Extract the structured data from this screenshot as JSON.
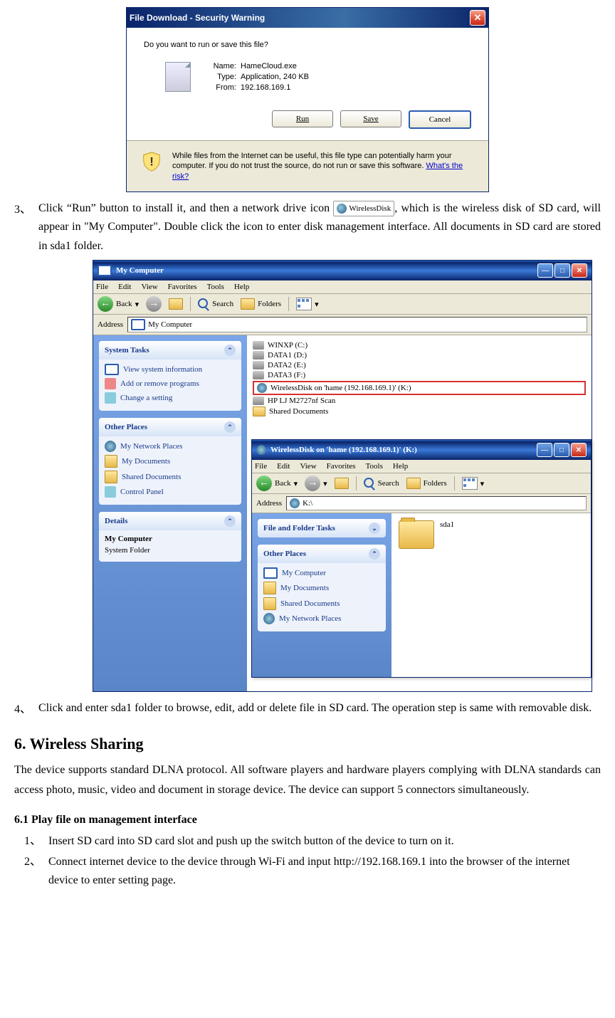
{
  "dialog": {
    "title": "File Download - Security Warning",
    "question": "Do you want to run or save this file?",
    "name_label": "Name:",
    "name_value": "HameCloud.exe",
    "type_label": "Type:",
    "type_value": "Application, 240 KB",
    "from_label": "From:",
    "from_value": "192.168.169.1",
    "btn_run": "Run",
    "btn_save": "Save",
    "btn_cancel": "Cancel",
    "warning": "While files from the Internet can be useful, this file type can potentially harm your computer. If you do not trust the source, do not run or save this software. ",
    "warning_link": "What's the risk?"
  },
  "step3": {
    "num": "3、",
    "t1": "Click “Run” button to install it, and then a network drive icon",
    "icon_label": "WirelessDisk",
    "t2": ", which is the wireless disk of SD card, will appear in \"My Computer\". Double click the icon to enter disk management interface. All documents in SD card are stored in sda1 folder."
  },
  "explorer1": {
    "title": "My Computer",
    "menu": [
      "File",
      "Edit",
      "View",
      "Favorites",
      "Tools",
      "Help"
    ],
    "toolbar": {
      "back": "Back",
      "search": "Search",
      "folders": "Folders"
    },
    "address_label": "Address",
    "address_value": "My Computer",
    "sidebar": {
      "panel1": {
        "title": "System Tasks",
        "items": [
          "View system information",
          "Add or remove programs",
          "Change a setting"
        ]
      },
      "panel2": {
        "title": "Other Places",
        "items": [
          "My Network Places",
          "My Documents",
          "Shared Documents",
          "Control Panel"
        ]
      },
      "panel3": {
        "title": "Details",
        "item": "My Computer",
        "sub": "System Folder"
      }
    },
    "drives": [
      "WINXP (C:)",
      "DATA1 (D:)",
      "DATA2 (E:)",
      "DATA3 (F:)"
    ],
    "hl_drive": "WirelessDisk on 'hame (192.168.169.1)' (K:)",
    "extra": [
      "HP LJ M2727nf Scan",
      "Shared Documents"
    ]
  },
  "explorer2": {
    "title": "WirelessDisk on 'hame (192.168.169.1)' (K:)",
    "menu": [
      "File",
      "Edit",
      "View",
      "Favorites",
      "Tools",
      "Help"
    ],
    "toolbar": {
      "back": "Back",
      "search": "Search",
      "folders": "Folders"
    },
    "address_label": "Address",
    "address_value": "K:\\",
    "sidebar": {
      "panel1": {
        "title": "File and Folder Tasks"
      },
      "panel2": {
        "title": "Other Places",
        "items": [
          "My Computer",
          "My Documents",
          "Shared Documents",
          "My Network Places"
        ]
      }
    },
    "folder": "sda1"
  },
  "step4": {
    "num": "4、",
    "text": "Click and enter sda1 folder to browse, edit, add or delete file in SD card. The operation step is same with removable disk."
  },
  "section6": {
    "heading": "6. Wireless Sharing",
    "body": "The device supports standard DLNA protocol. All software players and hardware players complying with DLNA standards can access photo, music, video and document in storage device. The device can support 5 connectors simultaneously.",
    "sub_heading": "6.1 Play file on management interface",
    "items": [
      {
        "num": "1、",
        "text": "Insert SD card into SD card slot and push up the switch button of the device to turn on it."
      },
      {
        "num": "2、",
        "text": "Connect internet device to the device through Wi-Fi and input http://192.168.169.1 into the browser of the internet device to enter setting page."
      }
    ]
  }
}
